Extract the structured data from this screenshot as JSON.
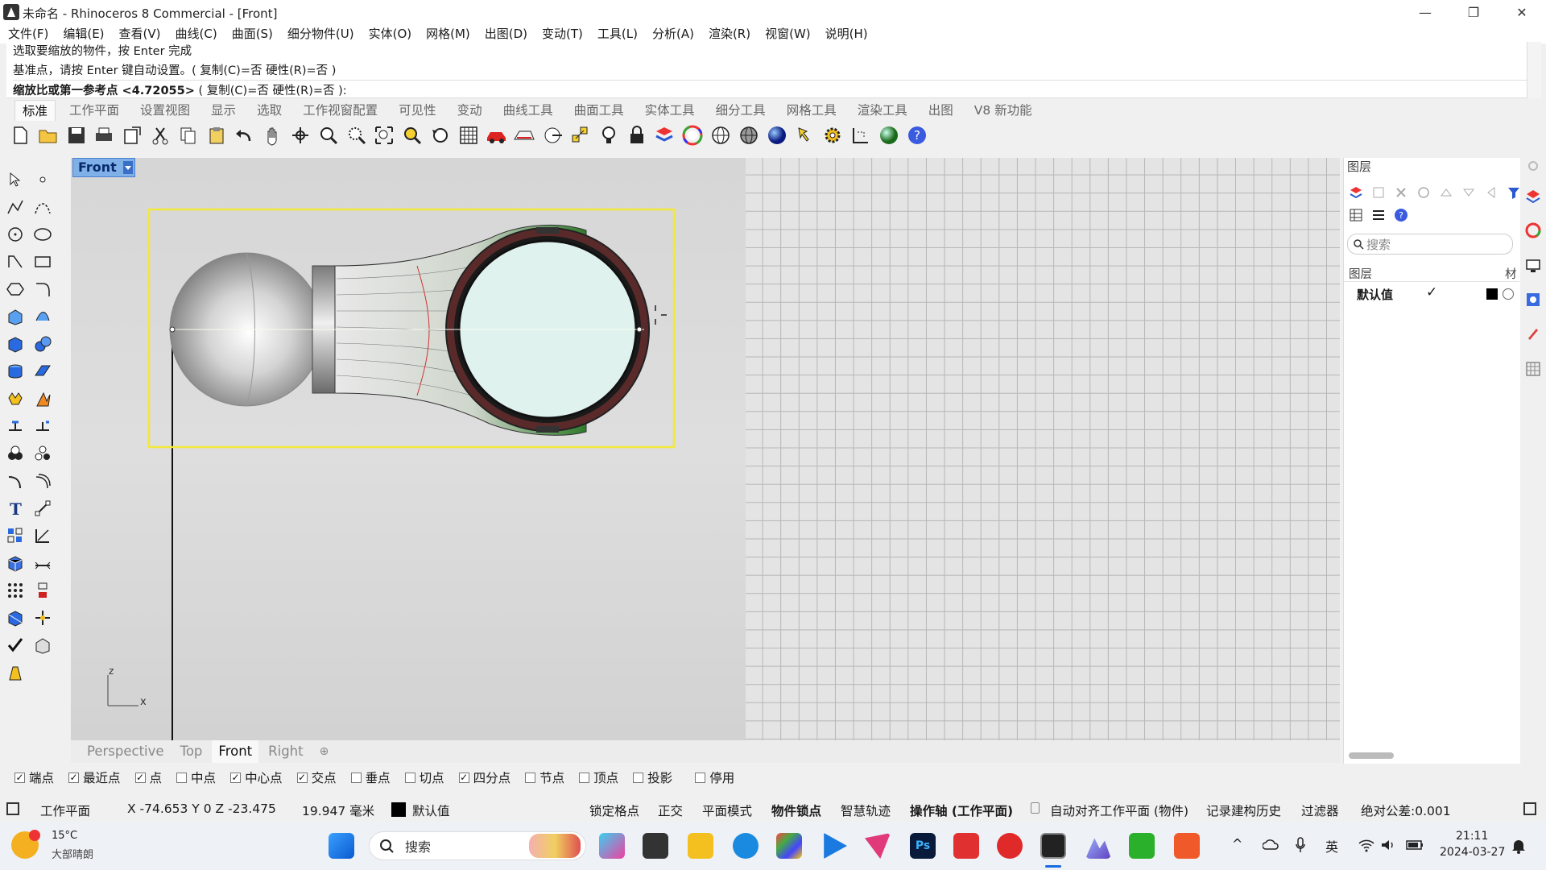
{
  "window": {
    "title": "未命名 - Rhinoceros 8 Commercial - [Front]",
    "minimize": "—",
    "restore": "❐",
    "close": "✕"
  },
  "menu": [
    "文件(F)",
    "编辑(E)",
    "查看(V)",
    "曲线(C)",
    "曲面(S)",
    "细分物件(U)",
    "实体(O)",
    "网格(M)",
    "出图(D)",
    "变动(T)",
    "工具(L)",
    "分析(A)",
    "渲染(R)",
    "视窗(W)",
    "说明(H)"
  ],
  "command": {
    "history_1": "选取要缩放的物件，按 Enter 完成",
    "history_2": "基准点，请按 Enter 键自动设置。( 复制(C)=否  硬性(R)=否 )",
    "prompt": "缩放比或第一参考点 <4.72055>",
    "prompt_options": " ( 复制(C)=否  硬性(R)=否 ):"
  },
  "toolbar_tabs": [
    "标准",
    "工作平面",
    "设置视图",
    "显示",
    "选取",
    "工作视窗配置",
    "可见性",
    "变动",
    "曲线工具",
    "曲面工具",
    "实体工具",
    "细分工具",
    "网格工具",
    "渲染工具",
    "出图",
    "V8 新功能"
  ],
  "viewport": {
    "label": "Front",
    "axis_z": "z",
    "axis_x": "x"
  },
  "view_tabs": [
    "Perspective",
    "Top",
    "Front",
    "Right"
  ],
  "layers_panel": {
    "title": "图层",
    "search_placeholder": "搜索",
    "column_layer": "图层",
    "column_material": "材",
    "default_layer": "默认值",
    "default_check": "✓"
  },
  "osnaps": [
    {
      "label": "端点",
      "checked": true
    },
    {
      "label": "最近点",
      "checked": true
    },
    {
      "label": "点",
      "checked": true
    },
    {
      "label": "中点",
      "checked": false
    },
    {
      "label": "中心点",
      "checked": true
    },
    {
      "label": "交点",
      "checked": true
    },
    {
      "label": "垂点",
      "checked": false
    },
    {
      "label": "切点",
      "checked": false
    },
    {
      "label": "四分点",
      "checked": true
    },
    {
      "label": "节点",
      "checked": false
    },
    {
      "label": "顶点",
      "checked": false
    },
    {
      "label": "投影",
      "checked": false
    },
    {
      "label": "停用",
      "checked": false
    }
  ],
  "status": {
    "cplane": "工作平面",
    "coords": "X -74.653 Y 0 Z -23.475",
    "distance": "19.947 毫米",
    "layer": "默认值",
    "grid_snap": "锁定格点",
    "ortho": "正交",
    "planar": "平面模式",
    "osnap": "物件锁点",
    "smarttrack": "智慧轨迹",
    "gumball": "操作轴 (工作平面)",
    "auto_align": "自动对齐工作平面 (物件)",
    "history": "记录建构历史",
    "filter": "过滤器",
    "tolerance": "绝对公差:0.001"
  },
  "taskbar": {
    "weather_temp": "15°C",
    "weather_desc": "大部晴朗",
    "search": "搜索",
    "ime": "英",
    "time": "21:11",
    "date": "2024-03-27"
  },
  "colors": {
    "selection_box": "#f2e83a",
    "viewport_label_bg": "#7fb0e8",
    "surface_green": "#2f7a2a"
  }
}
